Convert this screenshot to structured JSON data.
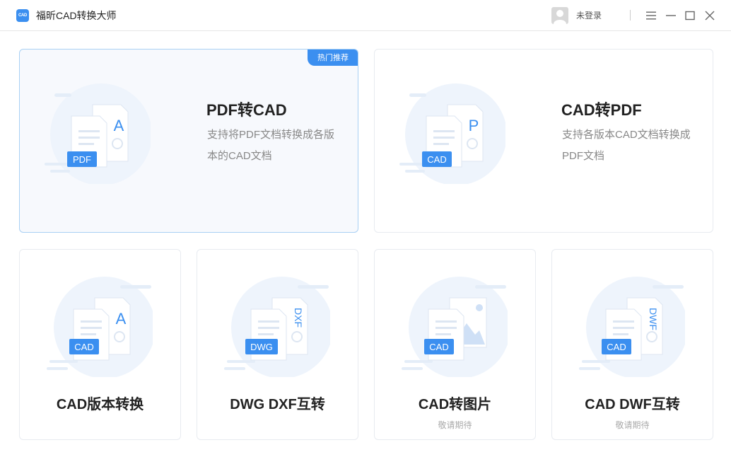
{
  "app": {
    "title": "福昕CAD转换大师",
    "logo_text": "CAD"
  },
  "user": {
    "login_label": "未登录"
  },
  "titlebar_icons": [
    "menu-icon",
    "minimize-icon",
    "maximize-icon",
    "close-icon"
  ],
  "colors": {
    "accent": "#3b8ff0",
    "active_border": "#a9d0f4",
    "active_bg": "#f7f9fd",
    "illustration_circle": "#eef4fc"
  },
  "featured": [
    {
      "title": "PDF转CAD",
      "desc": "支持将PDF文档转换成各版本的CAD文档",
      "badge": "热门推荐",
      "doc_tag": "PDF",
      "doc_glyph": "A"
    },
    {
      "title": "CAD转PDF",
      "desc": "支持各版本CAD文档转换成PDF文档",
      "doc_tag": "CAD",
      "doc_glyph": "P"
    }
  ],
  "tools": [
    {
      "title": "CAD版本转换",
      "subtitle": "",
      "doc_tag": "CAD",
      "doc_glyph": "A"
    },
    {
      "title": "DWG DXF互转",
      "subtitle": "",
      "doc_tag": "DWG",
      "doc_glyph": "DXF"
    },
    {
      "title": "CAD转图片",
      "subtitle": "敬请期待",
      "doc_tag": "CAD",
      "doc_glyph": ""
    },
    {
      "title": "CAD DWF互转",
      "subtitle": "敬请期待",
      "doc_tag": "CAD",
      "doc_glyph": "DWF"
    }
  ]
}
